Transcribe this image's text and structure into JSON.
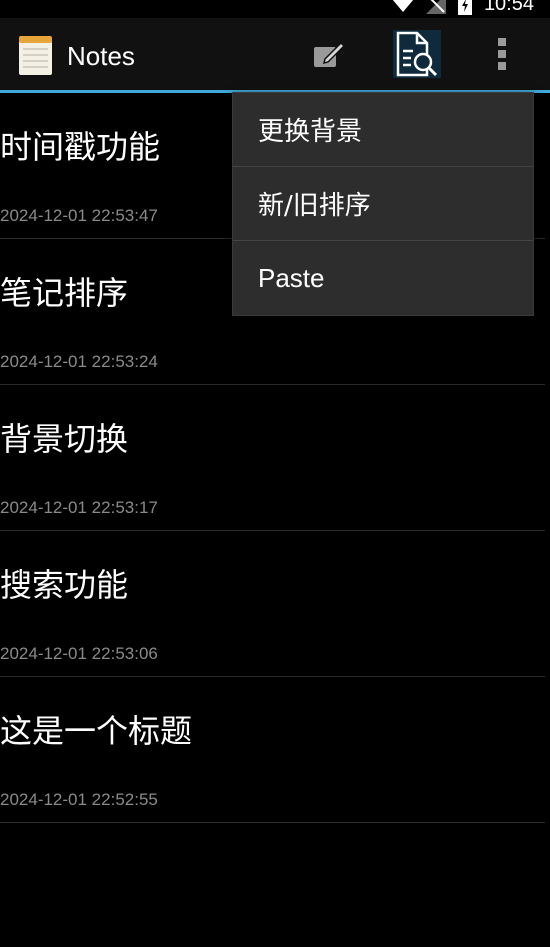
{
  "status_bar": {
    "time": "10:54",
    "icons": [
      "wifi-icon",
      "signal-icon",
      "battery-icon"
    ]
  },
  "action_bar": {
    "app_title": "Notes",
    "app_icon": "notepad-icon",
    "accent_color": "#3fa9d8",
    "actions": [
      {
        "name": "new-note-button",
        "icon": "edit-icon"
      },
      {
        "name": "search-button",
        "icon": "search-document-icon"
      },
      {
        "name": "overflow-menu-button",
        "icon": "more-vert-icon"
      }
    ]
  },
  "notes": [
    {
      "title": "时间戳功能",
      "date": "2024-12-01 22:53:47"
    },
    {
      "title": "笔记排序",
      "date": "2024-12-01 22:53:24"
    },
    {
      "title": "背景切换",
      "date": "2024-12-01 22:53:17"
    },
    {
      "title": "搜索功能",
      "date": "2024-12-01 22:53:06"
    },
    {
      "title": "这是一个标题",
      "date": "2024-12-01 22:52:55"
    }
  ],
  "overflow_menu": {
    "items": [
      {
        "label": "更换背景"
      },
      {
        "label": "新/旧排序"
      },
      {
        "label": "Paste"
      }
    ]
  }
}
